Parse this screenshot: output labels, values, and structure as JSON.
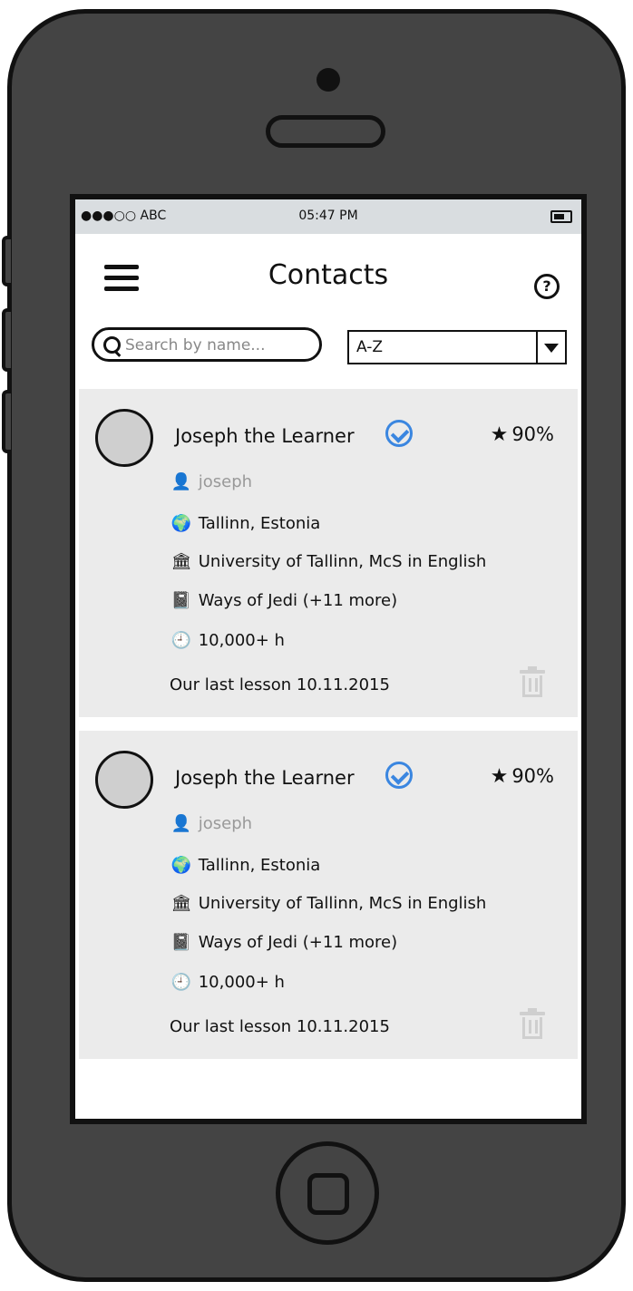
{
  "status_bar": {
    "carrier": "●●●○○ ABC",
    "time": "05:47 PM"
  },
  "header": {
    "title": "Contacts",
    "help_glyph": "?"
  },
  "search": {
    "placeholder": "Search by name..."
  },
  "sort": {
    "selected": "A-Z"
  },
  "icons": {
    "menu": "hamburger-icon",
    "help": "question-circle-icon",
    "search": "search-icon",
    "verified": "check-circle-icon",
    "star": "star-icon",
    "user": "user-icon",
    "location": "globe-icon",
    "school": "institution-icon",
    "subject": "book-icon",
    "hours": "clock-icon",
    "delete": "trash-icon",
    "dropdown": "caret-down-icon"
  },
  "colors": {
    "verified": "#3a86e0",
    "card_bg": "#ebebeb",
    "status_bg": "#d9dde0",
    "phone": "#444444"
  },
  "contacts": [
    {
      "name": "Joseph the Learner",
      "rating": "90%",
      "username": "joseph",
      "location": "Tallinn, Estonia",
      "school": "University of Tallinn, McS in English",
      "subjects": "Ways of Jedi (+11 more)",
      "hours": "10,000+ h",
      "last_lesson": "Our last lesson 10.11.2015"
    },
    {
      "name": "Joseph the Learner",
      "rating": "90%",
      "username": "joseph",
      "location": "Tallinn, Estonia",
      "school": "University of Tallinn, McS in English",
      "subjects": "Ways of Jedi (+11 more)",
      "hours": "10,000+ h",
      "last_lesson": "Our last lesson 10.11.2015"
    }
  ]
}
